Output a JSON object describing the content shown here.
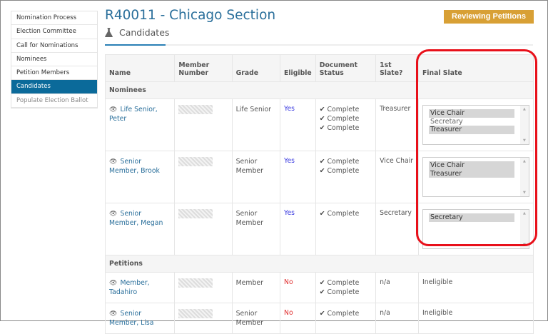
{
  "sidebar": {
    "items": [
      {
        "label": "Nomination Process"
      },
      {
        "label": "Election Committee"
      },
      {
        "label": "Call for Nominations"
      },
      {
        "label": "Nominees"
      },
      {
        "label": "Petition Members"
      },
      {
        "label": "Candidates",
        "active": true
      },
      {
        "label": "Populate Election Ballot",
        "disabled": true
      }
    ]
  },
  "header": {
    "title": "R40011 - Chicago Section",
    "status_button": "Reviewing Petitions",
    "subtitle": "Candidates",
    "subtitle_icon": "flask-icon"
  },
  "table": {
    "columns": [
      "Name",
      "Member Number",
      "Grade",
      "Eligible",
      "Document Status",
      "1st Slate?",
      "Final Slate"
    ],
    "groups": [
      {
        "label": "Nominees",
        "rows": [
          {
            "name": "Life Senior, Peter",
            "grade": "Life Senior",
            "eligible": "Yes",
            "docs": [
              "Complete",
              "Complete",
              "Complete"
            ],
            "first_slate": "Treasurer",
            "final_slate": [
              {
                "label": "Vice Chair",
                "selected": true
              },
              {
                "label": "Secretary",
                "selected": false
              },
              {
                "label": "Treasurer",
                "selected": true
              }
            ]
          },
          {
            "name": "Senior Member, Brook",
            "grade": "Senior Member",
            "eligible": "Yes",
            "docs": [
              "Complete",
              "Complete"
            ],
            "first_slate": "Vice Chair",
            "final_slate": [
              {
                "label": "Vice Chair",
                "selected": true
              },
              {
                "label": "Treasurer",
                "selected": true
              }
            ]
          },
          {
            "name": "Senior Member, Megan",
            "grade": "Senior Member",
            "eligible": "Yes",
            "docs": [
              "Complete"
            ],
            "first_slate": "Secretary",
            "final_slate": [
              {
                "label": "Secretary",
                "selected": true
              }
            ]
          }
        ]
      },
      {
        "label": "Petitions",
        "rows": [
          {
            "name": "Member, Tadahiro",
            "grade": "Member",
            "eligible": "No",
            "docs": [
              "Complete",
              "Complete"
            ],
            "first_slate": "n/a",
            "final_text": "Ineligible"
          },
          {
            "name": "Senior Member, Lisa",
            "grade": "Senior Member",
            "eligible": "No",
            "docs": [
              "Complete"
            ],
            "first_slate": "n/a",
            "final_text": "Ineligible"
          }
        ]
      }
    ]
  },
  "colors": {
    "accent": "#2a6f9b",
    "active_nav": "#0b6a9a",
    "status_button": "#d8a035",
    "highlight": "#e8101a"
  }
}
